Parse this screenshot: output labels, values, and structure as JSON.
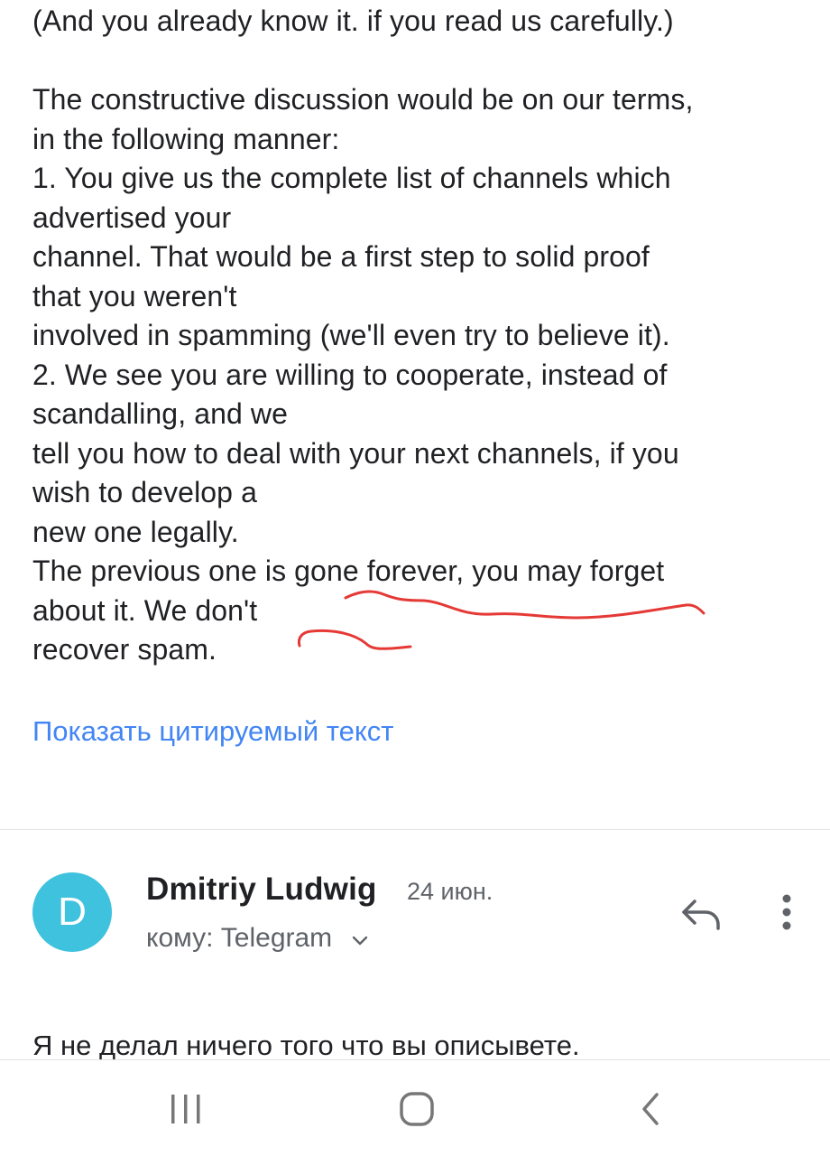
{
  "message": {
    "lines": [
      "(And you already know it. if you read us carefully.)",
      "",
      "The constructive discussion would be on our terms,",
      "in the following manner:",
      "1. You give us the complete list of channels which",
      "advertised your",
      "channel. That would be a first step to solid proof",
      "that you weren't",
      "involved in spamming (we'll even try to believe it).",
      "2. We see you are willing to cooperate, instead of",
      "scandalling, and we",
      "tell you how to deal with your next channels, if you",
      "wish to develop a",
      "new one legally.",
      "The previous one is gone forever, you may forget",
      "about it. We don't",
      "recover spam."
    ],
    "show_quoted_label": "Показать цитируемый текст"
  },
  "reply": {
    "avatar_letter": "D",
    "sender_name": "Dmitriy Ludwig",
    "date": "24 июн.",
    "recipient": "кому: Telegram",
    "preview_text": "Я не делал ничего того что вы описывете."
  },
  "icons": {
    "reply": "reply-icon",
    "more": "more-vert-icon",
    "recipient_expand": "chevron-down-icon",
    "nav_recent": "recent-apps-icon",
    "nav_home": "home-icon",
    "nav_back": "back-icon"
  },
  "colors": {
    "link": "#4285f4",
    "avatar": "#3fc2dd",
    "annotation": "#e53935",
    "text": "#202124",
    "secondary_text": "#5f6368"
  }
}
